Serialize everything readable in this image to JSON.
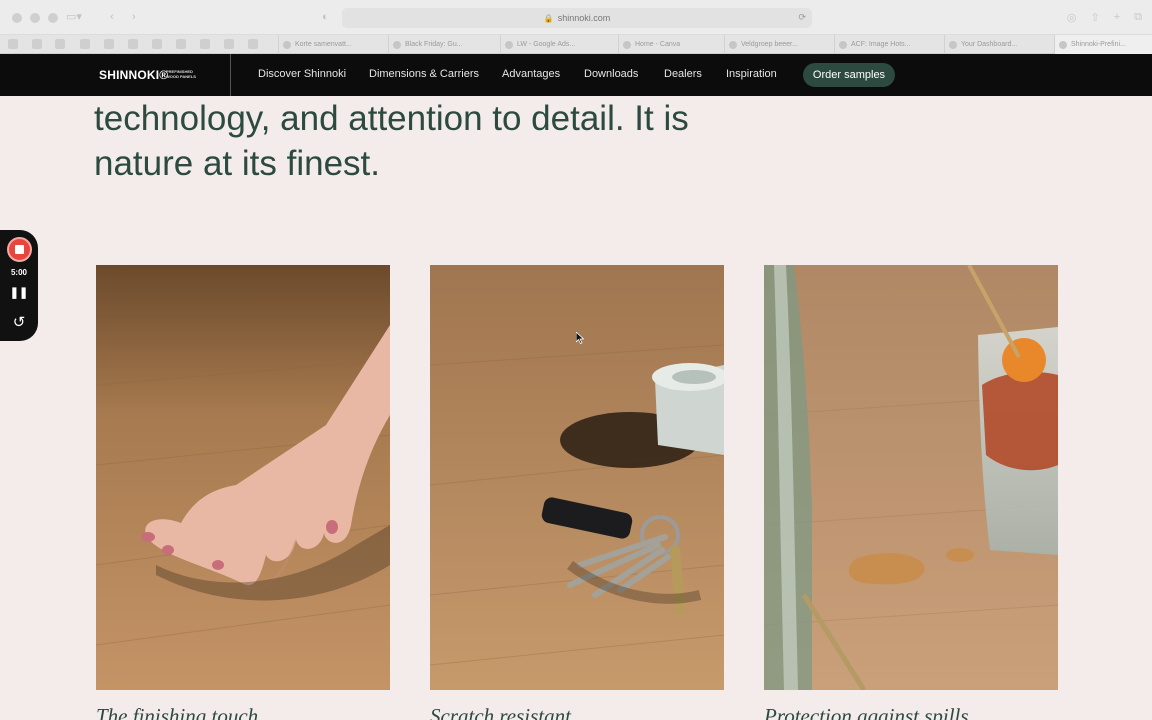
{
  "browser": {
    "url": "shinnoki.com",
    "tabs": [
      {
        "label": "Korte samenvatt..."
      },
      {
        "label": "Black Friday: Gu..."
      },
      {
        "label": "LW - Google Ads..."
      },
      {
        "label": "Home - Canva"
      },
      {
        "label": "Veldgroep beeer..."
      },
      {
        "label": "ACF: Image Hots..."
      },
      {
        "label": "Your Dashboard..."
      },
      {
        "label": "Shinnoki-Prefini..."
      }
    ]
  },
  "site": {
    "logo": "SHINNOKI®",
    "logo_sub": "PREFINISHED WOOD PANELS",
    "nav": [
      {
        "label": "Discover Shinnoki"
      },
      {
        "label": "Dimensions & Carriers"
      },
      {
        "label": "Advantages"
      },
      {
        "label": "Downloads"
      },
      {
        "label": "Dealers"
      },
      {
        "label": "Inspiration"
      }
    ],
    "cta": "Order samples",
    "accent_color": "#2c4a40"
  },
  "content": {
    "headline": "technology, and attention to detail. It is nature at its finest.",
    "cards": [
      {
        "caption": "The finishing touch",
        "image": "hand-on-wood-photo"
      },
      {
        "caption": "Scratch resistant",
        "image": "keys-on-wood-photo"
      },
      {
        "caption": "Protection against spills",
        "image": "cocktail-spill-photo"
      }
    ]
  },
  "recorder": {
    "time": "5:00",
    "pause_icon": "pause-icon",
    "restart_icon": "restart-icon"
  }
}
